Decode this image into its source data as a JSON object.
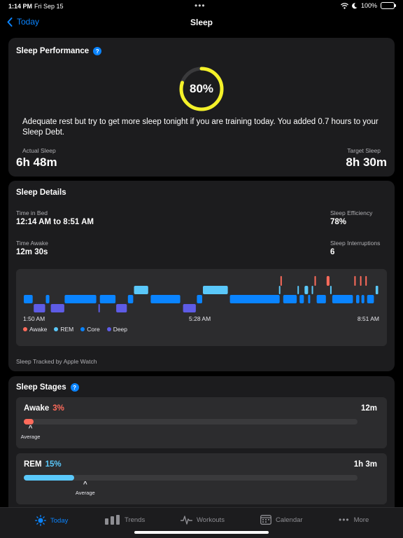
{
  "status_bar": {
    "time": "1:14 PM",
    "date": "Fri Sep 15",
    "battery": "100%"
  },
  "nav": {
    "back_label": "Today",
    "title": "Sleep"
  },
  "performance": {
    "title": "Sleep Performance",
    "percent": 0.8,
    "percent_label": "80%",
    "description": "Adequate rest but try to get more sleep tonight if you are training today.  You added 0.7 hours to your Sleep Debt.",
    "actual_label": "Actual Sleep",
    "actual_value": "6h 48m",
    "target_label": "Target Sleep",
    "target_value": "8h 30m",
    "colors": {
      "ring": "#f4f129",
      "track": "#3a3a3c"
    }
  },
  "details": {
    "title": "Sleep Details",
    "time_in_bed_label": "Time in Bed",
    "time_in_bed_value": "12:14 AM to 8:51 AM",
    "efficiency_label": "Sleep Efficiency",
    "efficiency_value": "78%",
    "time_awake_label": "Time Awake",
    "time_awake_value": "12m 30s",
    "interruptions_label": "Sleep Interruptions",
    "interruptions_value": "6",
    "tracked_by": "Sleep Tracked by Apple Watch"
  },
  "chart_data": {
    "type": "timeline",
    "x_start": "1:50 AM",
    "x_end": "8:51 AM",
    "tick_labels": [
      "1:50 AM",
      "5:28 AM",
      "8:51 AM"
    ],
    "stages": [
      "Awake",
      "REM",
      "Core",
      "Deep"
    ],
    "colors": {
      "Awake": "#ff6b5b",
      "REM": "#5ac8fa",
      "Core": "#0a84ff",
      "Deep": "#5e5ce6"
    },
    "legend": [
      {
        "name": "Awake",
        "color": "#ff6b5b"
      },
      {
        "name": "REM",
        "color": "#5ac8fa"
      },
      {
        "name": "Core",
        "color": "#0a84ff"
      },
      {
        "name": "Deep",
        "color": "#5e5ce6"
      }
    ],
    "legend_position": "bottom-left",
    "segments": [
      {
        "stage": "Core",
        "start": 0.0,
        "end": 0.025
      },
      {
        "stage": "Deep",
        "start": 0.028,
        "end": 0.06
      },
      {
        "stage": "Core",
        "start": 0.062,
        "end": 0.072
      },
      {
        "stage": "Deep",
        "start": 0.076,
        "end": 0.114
      },
      {
        "stage": "Core",
        "start": 0.115,
        "end": 0.204
      },
      {
        "stage": "Deep",
        "start": 0.21,
        "end": 0.213
      },
      {
        "stage": "Core",
        "start": 0.214,
        "end": 0.258
      },
      {
        "stage": "Deep",
        "start": 0.26,
        "end": 0.29
      },
      {
        "stage": "Core",
        "start": 0.293,
        "end": 0.308
      },
      {
        "stage": "REM",
        "start": 0.31,
        "end": 0.35
      },
      {
        "stage": "Core",
        "start": 0.357,
        "end": 0.44
      },
      {
        "stage": "Deep",
        "start": 0.448,
        "end": 0.484
      },
      {
        "stage": "Core",
        "start": 0.487,
        "end": 0.502
      },
      {
        "stage": "REM",
        "start": 0.504,
        "end": 0.574
      },
      {
        "stage": "Core",
        "start": 0.58,
        "end": 0.72
      },
      {
        "stage": "Awake",
        "start": 0.722,
        "end": 0.726
      },
      {
        "stage": "REM",
        "start": 0.718,
        "end": 0.721
      },
      {
        "stage": "Core",
        "start": 0.73,
        "end": 0.768
      },
      {
        "stage": "REM",
        "start": 0.77,
        "end": 0.773
      },
      {
        "stage": "Core",
        "start": 0.776,
        "end": 0.788
      },
      {
        "stage": "REM",
        "start": 0.79,
        "end": 0.8
      },
      {
        "stage": "Core",
        "start": 0.8,
        "end": 0.806
      },
      {
        "stage": "REM",
        "start": 0.81,
        "end": 0.814
      },
      {
        "stage": "Awake",
        "start": 0.818,
        "end": 0.822
      },
      {
        "stage": "Core",
        "start": 0.824,
        "end": 0.85
      },
      {
        "stage": "Awake",
        "start": 0.852,
        "end": 0.86
      },
      {
        "stage": "REM",
        "start": 0.862,
        "end": 0.866
      },
      {
        "stage": "Core",
        "start": 0.868,
        "end": 0.926
      },
      {
        "stage": "Awake",
        "start": 0.93,
        "end": 0.933
      },
      {
        "stage": "Core",
        "start": 0.935,
        "end": 0.944
      },
      {
        "stage": "Awake",
        "start": 0.946,
        "end": 0.949
      },
      {
        "stage": "Core",
        "start": 0.95,
        "end": 0.958
      },
      {
        "stage": "Awake",
        "start": 0.961,
        "end": 0.964
      },
      {
        "stage": "Core",
        "start": 0.966,
        "end": 0.985
      },
      {
        "stage": "REM",
        "start": 0.99,
        "end": 0.997
      }
    ]
  },
  "stages_section": {
    "title": "Sleep Stages",
    "average_label": "Average",
    "items": [
      {
        "name": "Awake",
        "percent_label": "3%",
        "fraction": 0.03,
        "average_fraction": 0.02,
        "duration": "12m",
        "color": "#ff6b5b"
      },
      {
        "name": "REM",
        "percent_label": "15%",
        "fraction": 0.15,
        "average_fraction": 0.184,
        "duration": "1h 3m",
        "color": "#5ac8fa"
      }
    ]
  },
  "tab_bar": {
    "tabs": [
      {
        "label": "Today",
        "icon": "sun-icon",
        "active": true
      },
      {
        "label": "Trends",
        "icon": "bar-chart-icon",
        "active": false
      },
      {
        "label": "Workouts",
        "icon": "heartbeat-icon",
        "active": false
      },
      {
        "label": "Calendar",
        "icon": "calendar-icon",
        "active": false
      },
      {
        "label": "More",
        "icon": "ellipsis-icon",
        "active": false
      }
    ]
  }
}
